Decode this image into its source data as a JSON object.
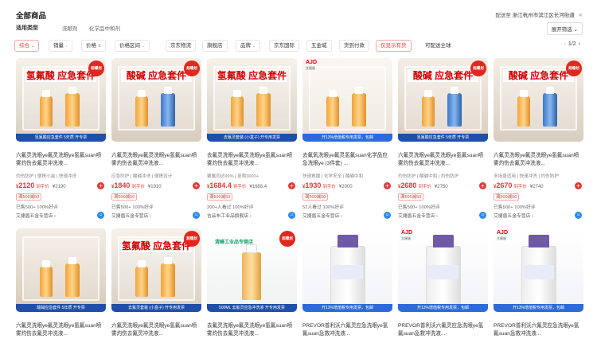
{
  "header": {
    "title": "全部商品",
    "ship_to_label": "配送至",
    "ship_to_value": "浙江杭州市滨江区长河街道",
    "ship_close": "✕",
    "usage_label": "适用类型",
    "usage_items": [
      "洗眼剂",
      "化学品中和剂"
    ],
    "expand_label": "展开筛选 ⌄"
  },
  "filters": [
    {
      "label": "综合",
      "caret": "⌄",
      "active": true
    },
    {
      "label": "销量",
      "caret": "↓",
      "active": false
    },
    {
      "label": "价格",
      "caret": "⇅",
      "active": false
    },
    {
      "label": "价格区间",
      "caret": "⌄",
      "active": false
    },
    {
      "label": "京东物流",
      "caret": "",
      "active": false
    },
    {
      "label": "旗舰店",
      "caret": "",
      "active": false
    },
    {
      "label": "品牌",
      "caret": "⌄",
      "active": false
    },
    {
      "label": "京东国际",
      "caret": "",
      "active": false
    },
    {
      "label": "五金城",
      "caret": "",
      "active": false
    },
    {
      "label": "货到付款",
      "caret": "",
      "active": false
    },
    {
      "label": "仅显示有货",
      "caret": "",
      "active": true
    },
    {
      "label": "可配送全球",
      "caret": "",
      "active": false
    }
  ],
  "pager": {
    "prev": "‹",
    "text": "1/2",
    "next": "›"
  },
  "products": [
    {
      "title": "六氟灵洗眼ye氟灵洗眼ye氢氟suan喷雾灼伤去氟灵冲洗液...",
      "tags": "灼伤防护 | 便携小盒 | 快速冲洗",
      "price": "2120",
      "price_tag": "到手价",
      "orig": "¥2190",
      "coupon": "满500减50",
      "sold": "已售500+ 100%好评",
      "shop": "艾捷盾五金专营店 ›",
      "cab_title": "氢氟酸 应急套件",
      "banner": "氢氟酸应急套件 5年质 开专票",
      "hot": "超爆划",
      "theme": "hf"
    },
    {
      "title": "六氟灵洗眼ye氟灵洗眼ye氢氟suan喷雾灼伤去氟灵冲洗液...",
      "tags": "应急防护 | 酸碱冲洗 | 便携设计",
      "price": "1840",
      "price_tag": "到手价",
      "orig": "¥1910",
      "coupon": "满500减50",
      "sold": "已售500+ 100%好评",
      "shop": "艾捷盾五金专营店 ›",
      "cab_title": "酸碱 应急套件",
      "banner": "",
      "hot": "超爆划",
      "theme": "acid"
    },
    {
      "title": "去氟灵洗眼ye氟灵洗眼ye氢氟suan喷雾灼伤去氟灵冲洗液...",
      "tags": "聚氟同达99% | 复购3000+",
      "price": "1684.4",
      "price_tag": "到手价",
      "orig": "¥1688.4",
      "coupon": "满500减50",
      "sold": "200+人看过 100%好评",
      "shop": "吉品布工业品旗舰店 ›",
      "cab_title": "氢氟酸 应急套件",
      "banner": "去氟灵套装 (小盒子) 开专用发票",
      "hot": "",
      "theme": "hf"
    },
    {
      "title": "去氟氧洗眼ye氟灵氢氟suan化学品应急洗眼ye (3件套) ...",
      "tags": "快速救援 | 化学安全 | 酸碱中和",
      "price": "1930",
      "price_tag": "到手价",
      "orig": "¥2000",
      "coupon": "满500减50",
      "sold": "52人看过 100%好评",
      "shop": "艾捷盾五金专营店 ›",
      "cab_title": "",
      "banner": "开13%增值税专用发票，包邮",
      "hot": "",
      "theme": "ajd",
      "ajd": "AJD",
      "ajd_sub": "艾捷盾"
    },
    {
      "title": "六氟灵洗眼ye氟灵洗眼ye氢氟suan喷雾灼伤去氟灵冲洗液...",
      "tags": "灼伤防护 | 酸碱中和 | 灼伤防护",
      "price": "2680",
      "price_tag": "到手价",
      "orig": "¥2750",
      "coupon": "满500减50",
      "sold": "已售500+ 100%好评",
      "shop": "艾捷盾五金专营店 ›",
      "cab_title": "酸碱 应急套件",
      "banner": "氢氟酸应急套件 5年质 开专票",
      "hot": "超爆划",
      "theme": "acid"
    },
    {
      "title": "六氟灵洗眼ye氟灵洗眼ye氢氟suan喷雾灼伤去氟灵冲洗液...",
      "tags": "多场景适用 | 快速冲洗 | 灼伤防护",
      "price": "2670",
      "price_tag": "到手价",
      "orig": "¥2740",
      "coupon": "满500减50",
      "sold": "已售500+ 100%好评",
      "shop": "艾捷盾五金专营店 ›",
      "cab_title": "酸碱 应急套件",
      "banner": "",
      "hot": "超爆划",
      "theme": "acid"
    },
    {
      "title": "六氟灵洗眼ye氟灵洗眼ye氢氟suan喷雾灼伤去氟灵冲洗液...",
      "cab_title": "",
      "banner": "酸碱应急套件 5年质 开专票",
      "hot": "",
      "theme": "small"
    },
    {
      "title": "六氟灵洗眼ye氟灵洗眼ye氢氟suan喷雾灼伤去氟灵冲洗液...",
      "cab_title": "氢氟酸 应急套件",
      "banner": "去氟灵套装 (小盒子) 开专用发票",
      "hot": "超爆划",
      "theme": "hf"
    },
    {
      "title": "去氟灵洗眼ye氟灵洗眼ye氢氟suan喷雾灼伤去氟灵冲洗液...",
      "cab_title": "",
      "banner": "500ML 去氟灵应急冲洗液 开专用发票",
      "hot": "超爆划",
      "theme": "bottle",
      "watermark": "清峰工业品专营店"
    },
    {
      "title": "PREVOR普利沃六氟灵应急洗眼ye氢氟suan急救冲洗液...",
      "cab_title": "",
      "banner": "开13%增值税专用发票，包邮",
      "hot": "",
      "theme": "prevor"
    },
    {
      "title": "PREVOR普利沃六氟灵应急洗眼ye氢氟suan急救冲洗液...",
      "cab_title": "",
      "banner": "开13%增值税专用发票，包邮",
      "hot": "",
      "theme": "prevor",
      "ajd": "AJD",
      "ajd_sub": "艾捷盾"
    },
    {
      "title": "PREVOR普利沃六氟灵应急洗眼ye氢氟suan急救冲洗液...",
      "cab_title": "",
      "banner": "开13%增值税专用发票，包邮",
      "hot": "",
      "theme": "prevor",
      "ajd": "AJD",
      "ajd_sub": "艾捷盾"
    }
  ],
  "colors": {
    "accent": "#e23a3a",
    "ws_blue": "#2d8cf0",
    "banner_blue": "#1f4fa8"
  }
}
